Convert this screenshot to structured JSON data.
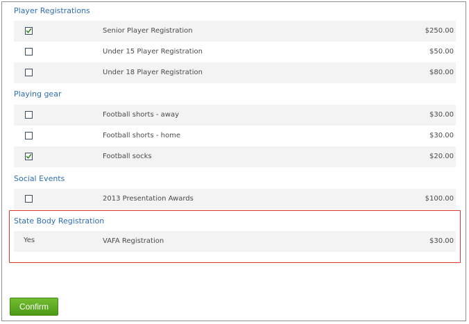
{
  "sections": {
    "player": {
      "title": "Player Registrations",
      "items": [
        {
          "name": "Senior Player Registration",
          "price": "$250.00",
          "checked": true
        },
        {
          "name": "Under 15 Player Registration",
          "price": "$50.00",
          "checked": false
        },
        {
          "name": "Under 18 Player Registration",
          "price": "$80.00",
          "checked": false
        }
      ]
    },
    "gear": {
      "title": "Playing gear",
      "items": [
        {
          "name": "Football shorts - away",
          "price": "$30.00",
          "checked": false
        },
        {
          "name": "Football shorts - home",
          "price": "$30.00",
          "checked": false
        },
        {
          "name": "Football socks",
          "price": "$20.00",
          "checked": true
        }
      ]
    },
    "social": {
      "title": "Social Events",
      "items": [
        {
          "name": "2013 Presentation Awards",
          "price": "$100.00",
          "checked": false
        }
      ]
    },
    "state": {
      "title": "State Body Registration",
      "items": [
        {
          "status": "Yes",
          "name": "VAFA Registration",
          "price": "$30.00"
        }
      ]
    }
  },
  "confirm_label": "Confirm",
  "colors": {
    "section_title": "#2f6db5",
    "row_shade": "#f3f3f3",
    "highlight_border": "#d9392b",
    "button_green": "#5aa81f"
  }
}
